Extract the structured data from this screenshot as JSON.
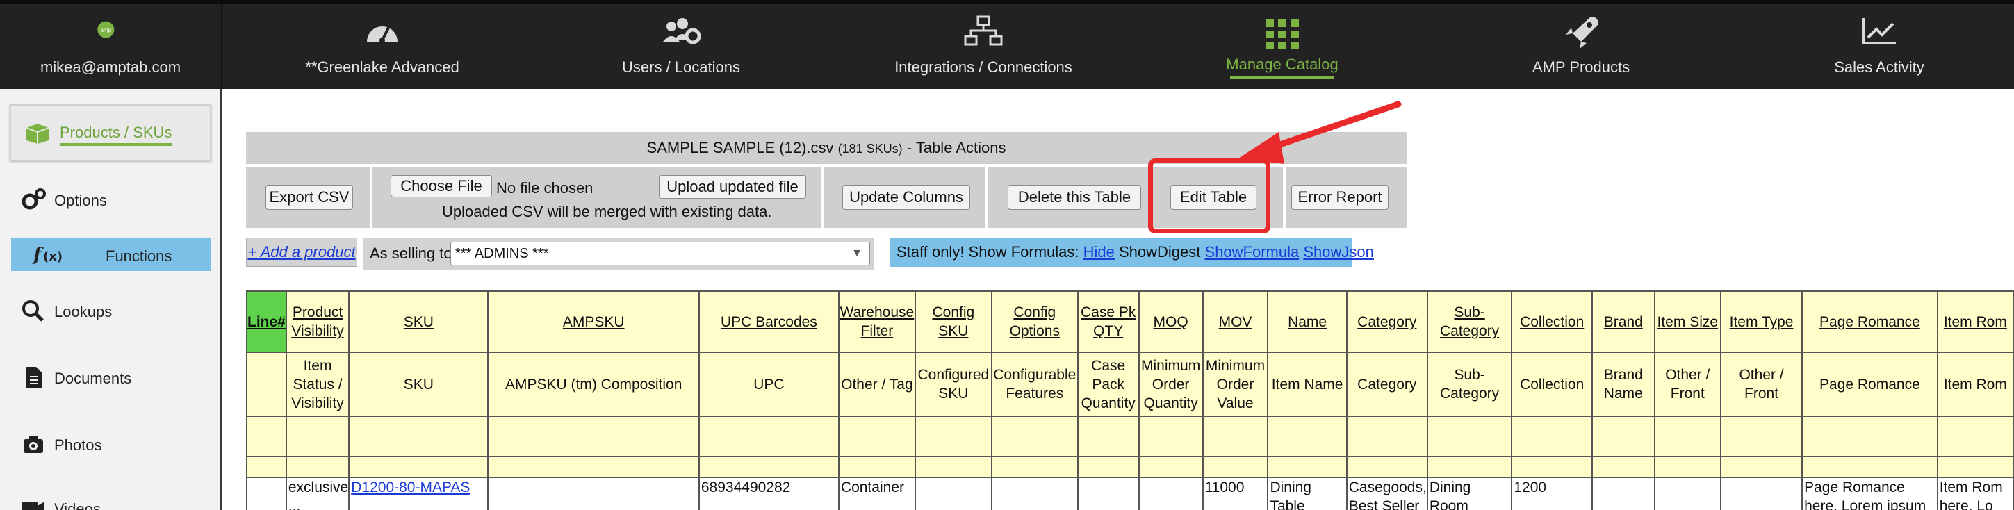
{
  "nav": {
    "user": "mikea@amptab.com",
    "logo_text": "amp",
    "items": [
      {
        "label": "**Greenlake Advanced",
        "icon": "dashboard-gauge-icon"
      },
      {
        "label": "Users / Locations",
        "icon": "users-gear-icon"
      },
      {
        "label": "Integrations / Connections",
        "icon": "network-icon"
      },
      {
        "label": "Manage Catalog",
        "icon": "grid-icon",
        "active": true
      },
      {
        "label": "AMP Products",
        "icon": "rocket-icon"
      },
      {
        "label": "Sales Activity",
        "icon": "line-chart-icon"
      }
    ],
    "active_color": "#7cb342"
  },
  "sidebar": {
    "items": [
      {
        "label": "Products / SKUs",
        "icon": "box-icon",
        "active": true
      },
      {
        "label": "Options",
        "icon": "gears-icon"
      },
      {
        "label": "Functions",
        "icon": "function-icon",
        "highlight": true
      },
      {
        "label": "Lookups",
        "icon": "search-icon"
      },
      {
        "label": "Documents",
        "icon": "document-icon"
      },
      {
        "label": "Photos",
        "icon": "camera-icon"
      },
      {
        "label": "Videos",
        "icon": "video-icon"
      }
    ]
  },
  "table_actions": {
    "title": "SAMPLE SAMPLE (12).csv",
    "count": "(181 SKUs)",
    "suffix": "- Table Actions",
    "export_csv": "Export CSV",
    "choose_file": "Choose File",
    "no_file": "No file chosen",
    "upload_updated": "Upload updated file",
    "merge_note": "Uploaded CSV will be merged with existing data.",
    "update_columns": "Update Columns",
    "delete_table": "Delete this Table",
    "edit_table": "Edit Table",
    "error_report": "Error Report"
  },
  "toolbar": {
    "add_product": "+ Add a product",
    "selling_label": "As selling to:",
    "selling_value": "*** ADMINS ***",
    "staff_label": "Staff only! Show Formulas:",
    "hide": "Hide",
    "show_digest": "ShowDigest",
    "show_formula": "ShowFormula",
    "show_json": "ShowJson"
  },
  "grid": {
    "headers": [
      "Line#",
      "Product Visibility",
      "SKU",
      "AMPSKU",
      "UPC Barcodes",
      "Warehouse Filter",
      "Config SKU",
      "Config Options",
      "Case Pk QTY",
      "MOQ",
      "MOV",
      "Name",
      "Category",
      "Sub-Category",
      "Collection",
      "Brand",
      "Item Size",
      "Item Type",
      "Page Romance",
      "Item Rom"
    ],
    "subheaders": [
      "",
      "Item Status / Visibility",
      "SKU",
      "AMPSKU (tm) Composition",
      "UPC",
      "Other / Tag",
      "Configured SKU",
      "Configurable Features",
      "Case Pack Quantity",
      "Minimum Order Quantity",
      "Minimum Order Value",
      "Item Name",
      "Category",
      "Sub-Category",
      "Collection",
      "Brand Name",
      "Other / Front",
      "Other / Front",
      "Page Romance",
      "Item Rom"
    ],
    "row": [
      "",
      "exclusive ...",
      "D1200-80-MAPAS",
      "",
      "68934490282",
      "Container",
      "",
      "",
      "",
      "",
      "11000",
      "Dining Table",
      "Casegoods, Best Seller",
      "Dining Room",
      "1200",
      "",
      "",
      "",
      "Page Romance here. Lorem ipsum",
      "Item Rom here. Lo"
    ]
  },
  "colors": {
    "highlight": "#ea2a2a",
    "table_bg": "#fffdc9",
    "accent_blue": "#7cc0e8"
  }
}
